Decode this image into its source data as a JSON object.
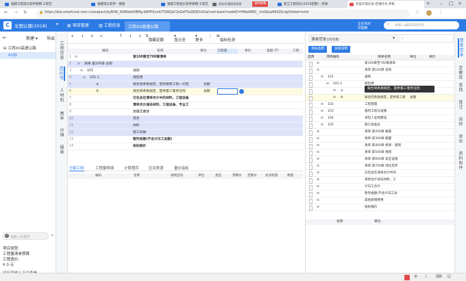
{
  "browser": {
    "tabs": [
      {
        "label": "福建工程造价软件新精·工程告"
      },
      {
        "label": "福建造价软件 - 搜索"
      },
      {
        "label": "福建工程造价软件新精·工程告"
      },
      {
        "label": "浙江工程造价(2018定额) - 检索"
      },
      {
        "label": "天设计造价云-在线计价,手机"
      }
    ],
    "extra_tab": "双击/右键关闭标签",
    "record_badge": "录制屏幕",
    "url": "https://dsk.smartcost.com.cn/subject/kyAVW_A0WbwOiBMg-bWPH/unit/TU9QpCQsGdY5sQfQDvXUa/cost-book?nodeID=MAwWNC_-UxGkya660Z&rightView=smb"
  },
  "app": {
    "project_name": "全国公路(2018)",
    "menu": [
      "项目管理",
      "工程信息"
    ],
    "active_file": "江西XX高速公路",
    "search_placeholder": "请输入编码或者名称",
    "user": "正在同步",
    "user_name": "邓超鹏"
  },
  "left_panel": {
    "new_label": "新建",
    "export_label": "导出",
    "tree": [
      {
        "label": "江西XX高速公路"
      },
      {
        "label": "A1标"
      }
    ],
    "search_placeholder": "请输入关键字",
    "project_type_label": "项目类型:",
    "project_type_value": "工程量清单预算",
    "cost_label": "工程造价:",
    "cost_value": "¥ 0 元",
    "footer": "没有其他人正在查看"
  },
  "left_vtabs": [
    "工程信息",
    "造价书",
    "人材机",
    "费率",
    "分摊",
    "报表"
  ],
  "toolbar": {
    "items": [
      "+",
      "↓",
      "×",
      "←",
      "↑",
      "↓",
      "↓"
    ],
    "hide_label": "隐藏定额",
    "display_label": "显示至",
    "more_label": "更多",
    "check_label": "指标检测"
  },
  "grid": {
    "headers": [
      "编号",
      "名称",
      "单位",
      "工程量",
      "单价",
      "金额 (F)",
      "工程"
    ],
    "rows": [
      {
        "num": "1",
        "code": "",
        "name": "第100章至700章清单",
        "unit": "",
        "qty": ""
      },
      {
        "num": "2",
        "code": "清单 第100章 总则",
        "name": "",
        "unit": "",
        "qty": ""
      },
      {
        "num": "3",
        "code": "101",
        "name": "通则",
        "unit": "",
        "qty": ""
      },
      {
        "num": "4",
        "code": "101-1",
        "name": "保险费",
        "unit": "",
        "qty": ""
      },
      {
        "num": "5",
        "code": "-a",
        "name": "按合同条款规定，提供建筑工程一切险",
        "unit": "总额",
        "qty": ""
      },
      {
        "num": "6",
        "code": "-b",
        "name": "按合同条款规定，提供第三者责任险",
        "unit": "总额",
        "qty": ""
      },
      {
        "num": "7",
        "code": "",
        "name": "已包含在清单合计中的材料、工程设备",
        "unit": "",
        "qty": ""
      },
      {
        "num": "8",
        "code": "",
        "name": "清单合计减去材料、工程设备、专业工",
        "unit": "",
        "qty": ""
      },
      {
        "num": "9",
        "code": "",
        "name": "计日工合计",
        "unit": "",
        "qty": ""
      },
      {
        "num": "10",
        "code": "",
        "name": "劳务",
        "unit": "",
        "qty": ""
      },
      {
        "num": "11",
        "code": "",
        "name": "材料",
        "unit": "",
        "qty": ""
      },
      {
        "num": "12",
        "code": "",
        "name": "施工机械",
        "unit": "",
        "qty": ""
      },
      {
        "num": "13",
        "code": "",
        "name": "暂列金额(不含计日工总额)",
        "unit": "",
        "qty": ""
      },
      {
        "num": "14",
        "code": "",
        "name": "投标报价",
        "unit": "",
        "qty": ""
      }
    ]
  },
  "bottom_panel": {
    "tabs": [
      "分部工料",
      "工程量明细",
      "计算程序",
      "区间来源",
      "量价指标"
    ],
    "headers": [
      "编码",
      "名称",
      "规格型号",
      "单位",
      "类型",
      "预算价",
      "定额价",
      "总消耗量",
      "数量"
    ]
  },
  "right_panel": {
    "title": "清单范本(2018)",
    "add_button": "添加选用",
    "check_button": "查看说明",
    "headers": [
      "选用",
      "项目编码",
      "清单名称",
      "单位",
      "单价"
    ],
    "rows": [
      {
        "code": "",
        "name": "第100章至700章清单",
        "unit": ""
      },
      {
        "code": "",
        "name": "清单 第100章 总则",
        "unit": ""
      },
      {
        "code": "101",
        "name": "通则",
        "unit": ""
      },
      {
        "code": "101-1",
        "name": "保险费",
        "unit": ""
      },
      {
        "code": "-a",
        "name": "按合同条款规定，提供建筑工程一切险",
        "unit": "总额"
      },
      {
        "code": "-b",
        "name": "按合同条款规定，提供第三者责任险",
        "unit": "总额"
      },
      {
        "code": "102",
        "name": "工程管理",
        "unit": ""
      },
      {
        "code": "103",
        "name": "临时工程与设施",
        "unit": ""
      },
      {
        "code": "104",
        "name": "承包人驻地建设",
        "unit": ""
      },
      {
        "code": "105",
        "name": "施工标准化",
        "unit": ""
      },
      {
        "code": "",
        "name": "清单 第200章 路基",
        "unit": ""
      },
      {
        "code": "",
        "name": "清单 第300章 路面",
        "unit": ""
      },
      {
        "code": "",
        "name": "清单 第400章 桥梁、涵洞",
        "unit": ""
      },
      {
        "code": "",
        "name": "清单 第500章 隧道",
        "unit": ""
      },
      {
        "code": "",
        "name": "清单 第600章 安全设施",
        "unit": ""
      },
      {
        "code": "",
        "name": "清单 第700章 绿化及环",
        "unit": ""
      },
      {
        "code": "",
        "name": "已包含在清单合计中的",
        "unit": ""
      },
      {
        "code": "",
        "name": "清单合计减去材料、工",
        "unit": ""
      },
      {
        "code": "",
        "name": "计日工合计",
        "unit": ""
      },
      {
        "code": "",
        "name": "暂列金额(不含计日工总",
        "unit": ""
      },
      {
        "code": "",
        "name": "其他新增费用",
        "unit": ""
      },
      {
        "code": "",
        "name": "投标报价",
        "unit": ""
      }
    ],
    "tooltip": "按合同条款规定，提供第三者责任险",
    "bottom_headers": [
      "名称",
      "单位"
    ]
  },
  "right_vtabs": [
    "清单范本",
    "定额库",
    "查找",
    "批注",
    "自检",
    "呆伍",
    "资料附件"
  ],
  "colors": {
    "brand": "#2c7be5",
    "selected_row": "#fffbe0",
    "lavender_row": "#dde3fb"
  }
}
